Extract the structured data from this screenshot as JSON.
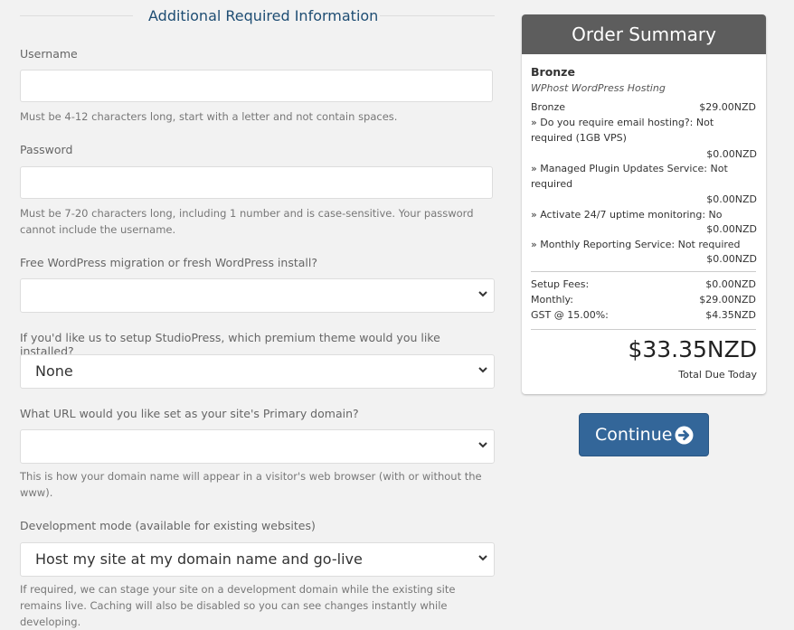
{
  "form": {
    "section_title": "Additional Required Information",
    "username": {
      "label": "Username",
      "value": "",
      "help": "Must be 4-12 characters long, start with a letter and not contain spaces."
    },
    "password": {
      "label": "Password",
      "value": "",
      "help": "Must be 7-20 characters long, including 1 number and is case-sensitive. Your password cannot include the username."
    },
    "migration": {
      "label": "Free WordPress migration or fresh WordPress install?",
      "value": ""
    },
    "theme": {
      "label": "If you'd like us to setup StudioPress, which premium theme would you like installed?",
      "value": "None"
    },
    "primary_url": {
      "label": "What URL would you like set as your site's Primary domain?",
      "value": "",
      "help": "This is how your domain name will appear in a visitor's web browser (with or without the www)."
    },
    "dev_mode": {
      "label": "Development mode (available for existing websites)",
      "value": "Host my site at my domain name and go-live",
      "help": "If required, we can stage your site on a development domain while the existing site remains live. Caching will also be disabled so you can see changes instantly while developing."
    }
  },
  "summary": {
    "title": "Order Summary",
    "product_name": "Bronze",
    "product_group": "WPhost WordPress Hosting",
    "base_label": "Bronze",
    "base_price": "$29.00NZD",
    "addons": [
      {
        "label": "» Do you require email hosting?: Not required (1GB VPS)",
        "price": "$0.00NZD"
      },
      {
        "label": "» Managed Plugin Updates Service: Not required",
        "price": "$0.00NZD"
      },
      {
        "label": "» Activate 24/7 uptime monitoring: No",
        "price": "$0.00NZD"
      },
      {
        "label": "» Monthly Reporting Service: Not required",
        "price": "$0.00NZD"
      }
    ],
    "setup_label": "Setup Fees:",
    "setup_value": "$0.00NZD",
    "monthly_label": "Monthly:",
    "monthly_value": "$29.00NZD",
    "gst_label": "GST @ 15.00%:",
    "gst_value": "$4.35NZD",
    "total": "$33.35NZD",
    "total_label": "Total Due Today"
  },
  "continue_button": {
    "label": "Continue",
    "icon": "circle-arrow-right-icon",
    "color": "#336699"
  }
}
